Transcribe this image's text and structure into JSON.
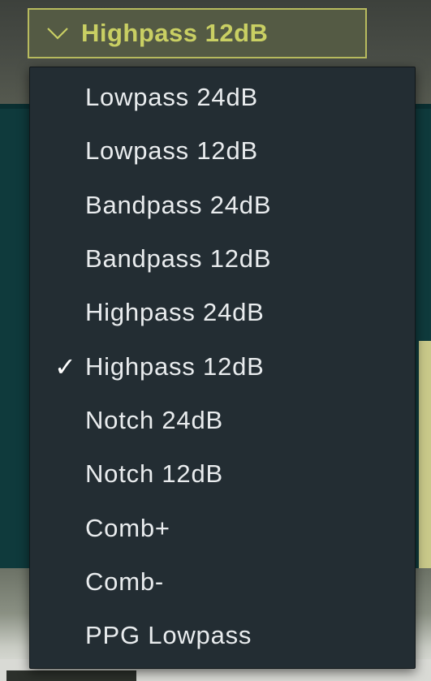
{
  "dropdown": {
    "selected_label": "Highpass 12dB",
    "accent_color": "#c9cf63",
    "border_color": "#b8bb5e"
  },
  "menu": {
    "items": [
      {
        "label": "Lowpass 24dB",
        "checked": false
      },
      {
        "label": "Lowpass 12dB",
        "checked": false
      },
      {
        "label": "Bandpass 24dB",
        "checked": false
      },
      {
        "label": "Bandpass 12dB",
        "checked": false
      },
      {
        "label": "Highpass 24dB",
        "checked": false
      },
      {
        "label": "Highpass 12dB",
        "checked": true
      },
      {
        "label": "Notch 24dB",
        "checked": false
      },
      {
        "label": "Notch 12dB",
        "checked": false
      },
      {
        "label": "Comb+",
        "checked": false
      },
      {
        "label": "Comb-",
        "checked": false
      },
      {
        "label": "PPG Lowpass",
        "checked": false
      }
    ],
    "check_glyph": "✓",
    "background_color": "#232d33",
    "text_color": "#e9ecee"
  },
  "icons": {
    "dropdown_chevron": "chevron-down-icon",
    "selected_mark": "checkmark-icon"
  }
}
